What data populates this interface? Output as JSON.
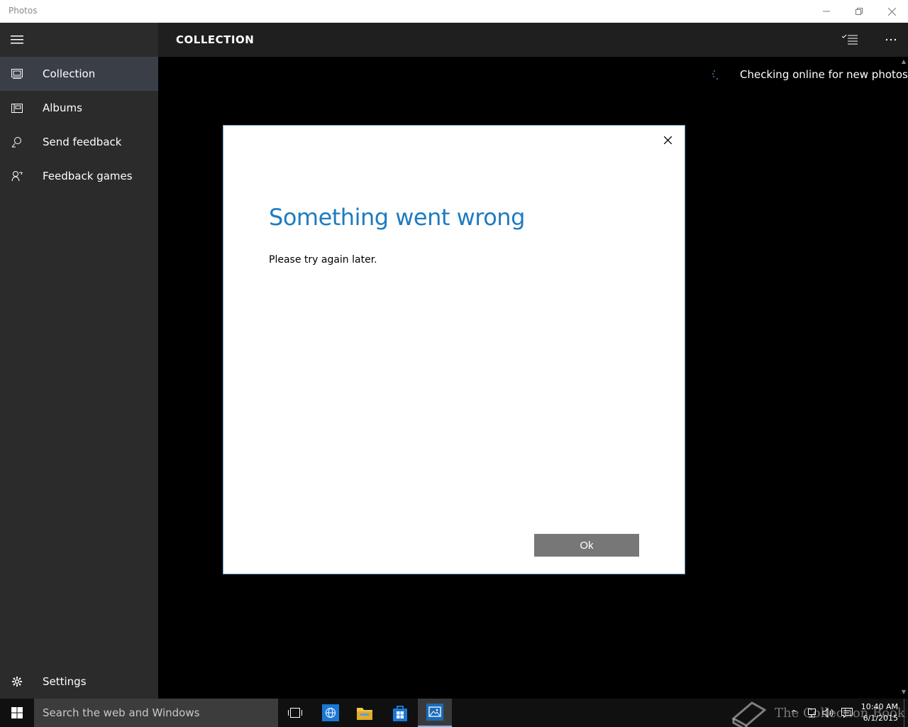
{
  "window": {
    "app_title": "Photos",
    "controls": [
      "minimize-icon",
      "restore-icon",
      "close-icon"
    ]
  },
  "nav": {
    "menu_icon": "hamburger-icon",
    "items": [
      {
        "label": "Collection",
        "icon": "collection-icon",
        "selected": true
      },
      {
        "label": "Albums",
        "icon": "album-icon",
        "selected": false
      },
      {
        "label": "Send feedback",
        "icon": "feedback-icon",
        "selected": false
      },
      {
        "label": "Feedback games",
        "icon": "games-icon",
        "selected": false
      }
    ],
    "settings_label": "Settings"
  },
  "header": {
    "title": "COLLECTION",
    "select_icon": "select-list-icon",
    "more_icon": "more-icon"
  },
  "status": {
    "text": "Checking online for new photos"
  },
  "dialog": {
    "title": "Something went wrong",
    "message": "Please try again later.",
    "ok_label": "Ok"
  },
  "taskbar": {
    "search_placeholder": "Search the web and Windows",
    "apps": [
      "task-view-icon",
      "browser-icon",
      "file-explorer-icon",
      "store-icon",
      "photos-icon"
    ],
    "watermark_text": "The Collection Book",
    "time": "10:40 AM",
    "date": "6/1/2015"
  },
  "colors": {
    "accent": "#1f7bc1",
    "nav_bg": "#2b2b2b",
    "nav_selected": "#3a3f47",
    "header_bg": "#1f1f1f"
  }
}
